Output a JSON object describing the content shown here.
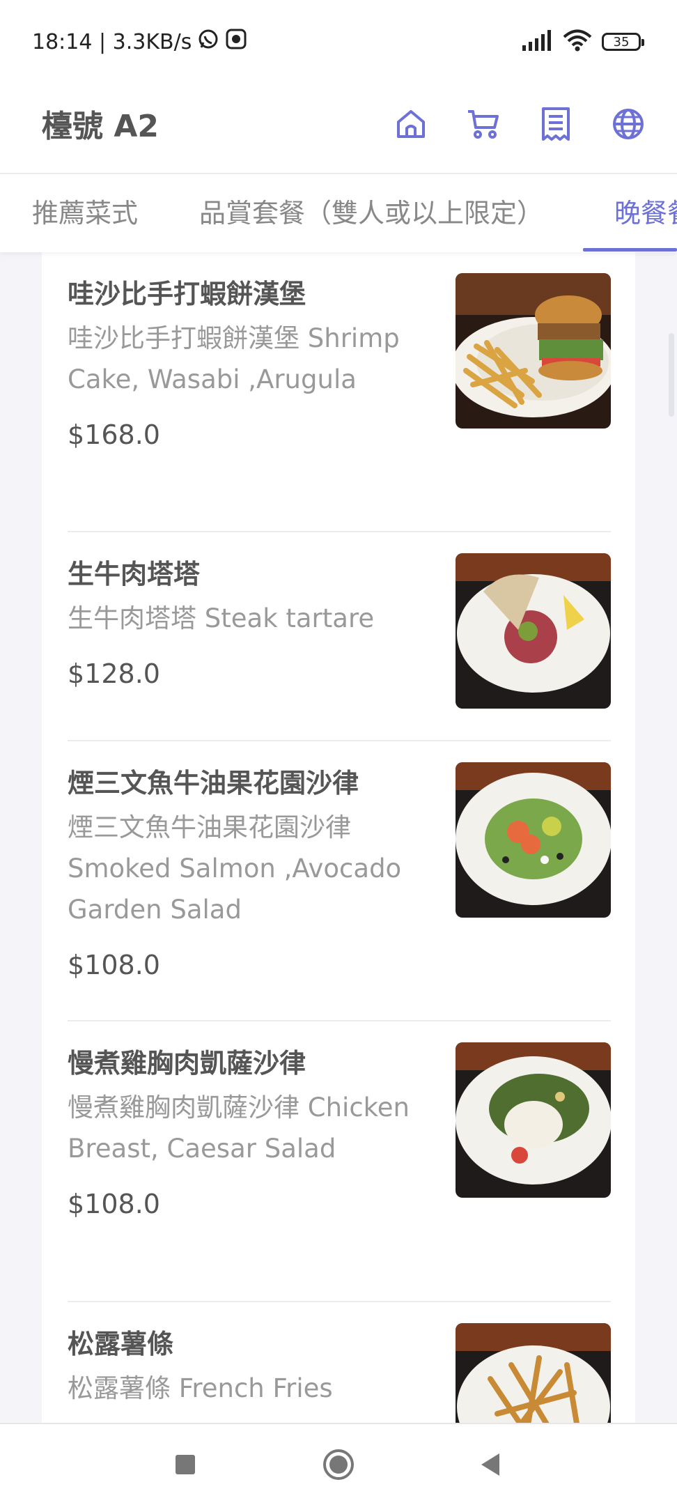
{
  "status_bar": {
    "time_speed": "18:14 | 3.3KB/s",
    "battery": "35",
    "icons": [
      "whatsapp-icon",
      "screen-record-icon",
      "signal-icon",
      "wifi-icon",
      "battery-icon"
    ]
  },
  "header": {
    "table_name": "檯號 A2",
    "icons": [
      "home-icon",
      "cart-icon",
      "receipt-icon",
      "globe-icon"
    ],
    "accent_color": "#6d71d6"
  },
  "tabs": [
    {
      "label": "推薦菜式",
      "active": false
    },
    {
      "label": "品賞套餐（雙人或以上限定）",
      "active": false
    },
    {
      "label": "晚餐餐",
      "active": true
    }
  ],
  "menu_items": [
    {
      "name": "哇沙比手打蝦餅漢堡",
      "description": "哇沙比手打蝦餅漢堡 Shrimp Cake, Wasabi ,Arugula",
      "price": "$168.0",
      "photo": "burger-with-fries"
    },
    {
      "name": "生牛肉塔塔",
      "description": "生牛肉塔塔 Steak tartare",
      "price": "$128.0",
      "photo": "steak-tartare"
    },
    {
      "name": "煙三文魚牛油果花園沙律",
      "description": "煙三文魚牛油果花園沙律 Smoked Salmon ,Avocado Garden Salad",
      "price": "$108.0",
      "photo": "salmon-salad"
    },
    {
      "name": "慢煮雞胸肉凱薩沙律",
      "description": "慢煮雞胸肉凱薩沙律 Chicken Breast, Caesar Salad",
      "price": "$108.0",
      "photo": "caesar-salad"
    },
    {
      "name": "松露薯條",
      "description": "松露薯條 French Fries",
      "price": "",
      "photo": "french-fries"
    }
  ],
  "nav_bar": {
    "buttons": [
      "recent-apps-button",
      "home-button",
      "back-button"
    ]
  }
}
